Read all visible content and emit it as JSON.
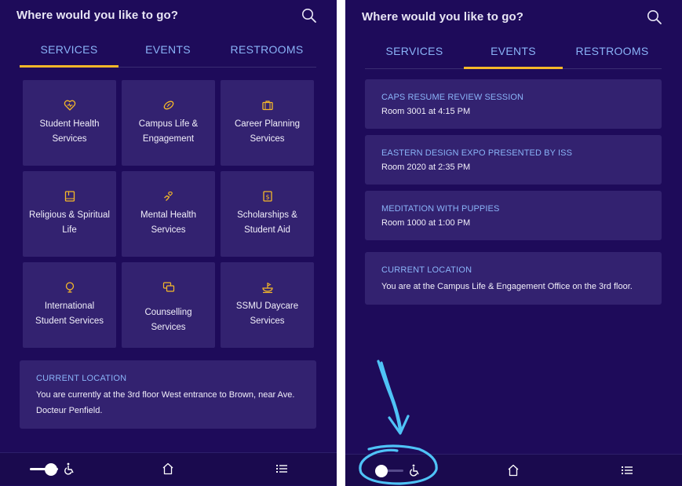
{
  "colors": {
    "background": "#1e0b5a",
    "card": "#332270",
    "accent_blue": "#8ab4f8",
    "tab_underline": "#f5b829",
    "icon_gold": "#f5b829",
    "annotation": "#4fc3f7"
  },
  "left": {
    "header": {
      "title": "Where would you like to go?",
      "search_icon": "search-icon"
    },
    "tabs": [
      {
        "label": "SERVICES",
        "active": true
      },
      {
        "label": "EVENTS",
        "active": false
      },
      {
        "label": "RESTROOMS",
        "active": false
      }
    ],
    "services": [
      {
        "icon": "heart-icon",
        "line1": "Student Health",
        "line2": "Services"
      },
      {
        "icon": "football-icon",
        "line1": "Campus Life &",
        "line2": "Engagement"
      },
      {
        "icon": "briefcase-icon",
        "line1": "Career Planning",
        "line2": "Services"
      },
      {
        "icon": "book-icon",
        "line1": "Religious & Spiritual",
        "line2": "Life"
      },
      {
        "icon": "hand-heart-icon",
        "line1": "Mental Health",
        "line2": "Services"
      },
      {
        "icon": "dollar-doc-icon",
        "line1": "Scholarships &",
        "line2": "Student Aid"
      },
      {
        "icon": "globe-icon",
        "line1": "International",
        "line2": "Student Services"
      },
      {
        "icon": "chat-icon",
        "line1": "Counselling Services",
        "line2": ""
      },
      {
        "icon": "daycare-icon",
        "line1": "SSMU Daycare",
        "line2": "Services"
      }
    ],
    "location": {
      "title": "CURRENT LOCATION",
      "line1": "You are currently at the 3rd floor West entrance to Brown, near Ave.",
      "line2": "Docteur Penfield."
    },
    "footer": {
      "accessibility_toggle_on": true,
      "wheelchair_icon": "wheelchair-icon",
      "home_icon": "home-icon",
      "menu_icon": "list-icon"
    }
  },
  "right": {
    "header": {
      "title": "Where would you like to go?",
      "search_icon": "search-icon"
    },
    "tabs": [
      {
        "label": "SERVICES",
        "active": false
      },
      {
        "label": "EVENTS",
        "active": true
      },
      {
        "label": "RESTROOMS",
        "active": false
      }
    ],
    "events": [
      {
        "title": "CAPS RESUME REVIEW SESSION",
        "detail": "Room 3001 at 4:15 PM"
      },
      {
        "title": "EASTERN DESIGN EXPO PRESENTED BY ISS",
        "detail": "Room 2020 at 2:35 PM"
      },
      {
        "title": "MEDITATION WITH PUPPIES",
        "detail": "Room 1000 at 1:00 PM"
      }
    ],
    "location": {
      "title": "CURRENT LOCATION",
      "text": "You are at the Campus Life & Engagement Office on the 3rd floor."
    },
    "footer": {
      "accessibility_toggle_on": false,
      "wheelchair_icon": "wheelchair-icon",
      "home_icon": "home-icon",
      "menu_icon": "list-icon"
    }
  }
}
